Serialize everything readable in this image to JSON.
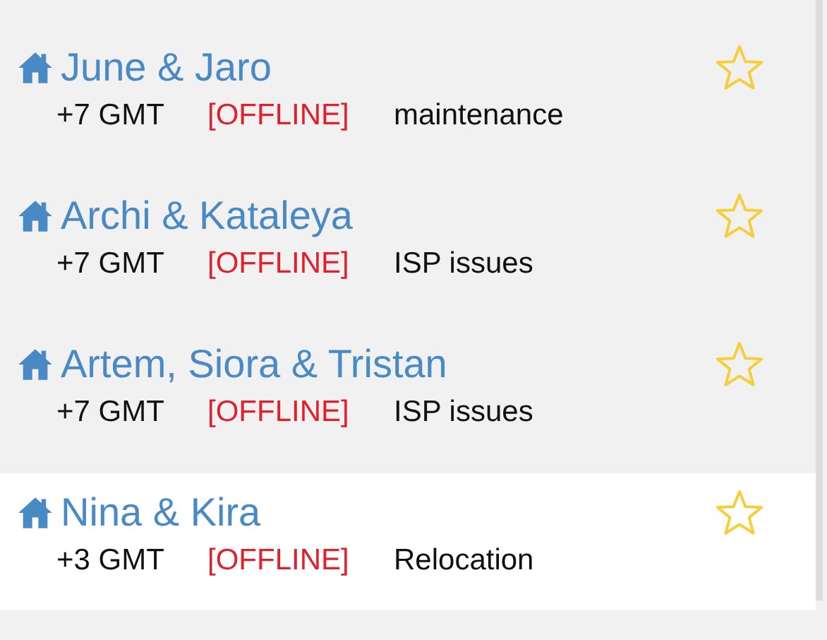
{
  "contacts": [
    {
      "name": "June & Jaro",
      "timezone": "+7 GMT",
      "status": "[OFFLINE]",
      "note": "maintenance",
      "starred": false,
      "selected": false
    },
    {
      "name": "Archi & Kataleya",
      "timezone": "+7 GMT",
      "status": "[OFFLINE]",
      "note": "ISP issues",
      "starred": false,
      "selected": false
    },
    {
      "name": "Artem, Siora & Tristan",
      "timezone": "+7 GMT",
      "status": "[OFFLINE]",
      "note": "ISP issues",
      "starred": false,
      "selected": false
    },
    {
      "name": "Nina & Kira",
      "timezone": "+3 GMT",
      "status": "[OFFLINE]",
      "note": "Relocation",
      "starred": false,
      "selected": true
    }
  ]
}
